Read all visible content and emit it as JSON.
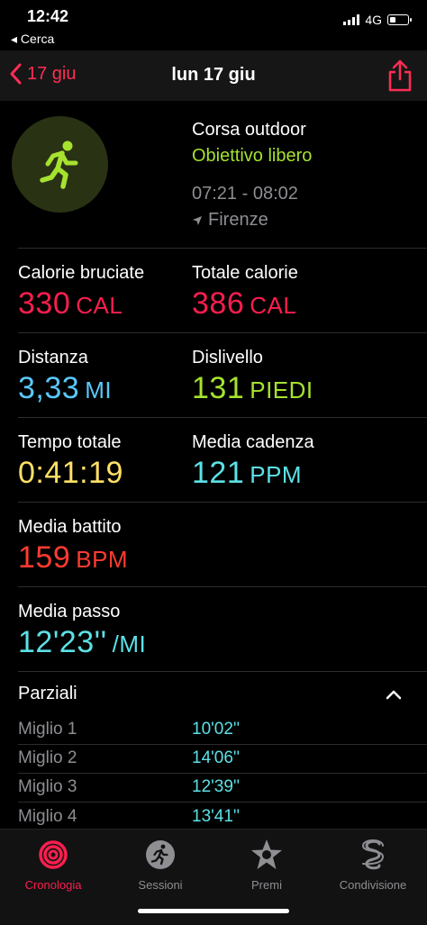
{
  "status": {
    "time": "12:42",
    "back_label": "◂ Cerca",
    "network": "4G"
  },
  "nav": {
    "back_label": "17 giu",
    "title": "lun 17 giu"
  },
  "workout": {
    "title": "Corsa outdoor",
    "goal": "Obiettivo libero",
    "time_range": "07:21 - 08:02",
    "location": "Firenze"
  },
  "metrics": {
    "cal_burned": {
      "label": "Calorie bruciate",
      "value": "330",
      "unit": "CAL"
    },
    "total_cal": {
      "label": "Totale calorie",
      "value": "386",
      "unit": "CAL"
    },
    "distance": {
      "label": "Distanza",
      "value": "3,33",
      "unit": "MI"
    },
    "elevation": {
      "label": "Dislivello",
      "value": "131",
      "unit": "PIEDI"
    },
    "total_time": {
      "label": "Tempo totale",
      "value": "0:41:19"
    },
    "cadence": {
      "label": "Media cadenza",
      "value": "121",
      "unit": "PPM"
    },
    "heart_rate": {
      "label": "Media battito",
      "value": "159",
      "unit": "BPM"
    },
    "pace": {
      "label": "Media passo",
      "value": "12'23''",
      "unit": "/MI"
    }
  },
  "splits": {
    "title": "Parziali",
    "rows": [
      {
        "label": "Miglio 1",
        "value": "10'02''"
      },
      {
        "label": "Miglio 2",
        "value": "14'06''"
      },
      {
        "label": "Miglio 3",
        "value": "12'39''"
      },
      {
        "label": "Miglio 4",
        "value": "13'41''"
      }
    ]
  },
  "tabs": [
    {
      "label": "Cronologia"
    },
    {
      "label": "Sessioni"
    },
    {
      "label": "Premi"
    },
    {
      "label": "Condivisione"
    }
  ],
  "colors": {
    "accent": "#fa1e4e",
    "green": "#a6e22e",
    "blue": "#5ac8fa",
    "yellow": "#ffe066",
    "cyan": "#5ce1e6"
  }
}
